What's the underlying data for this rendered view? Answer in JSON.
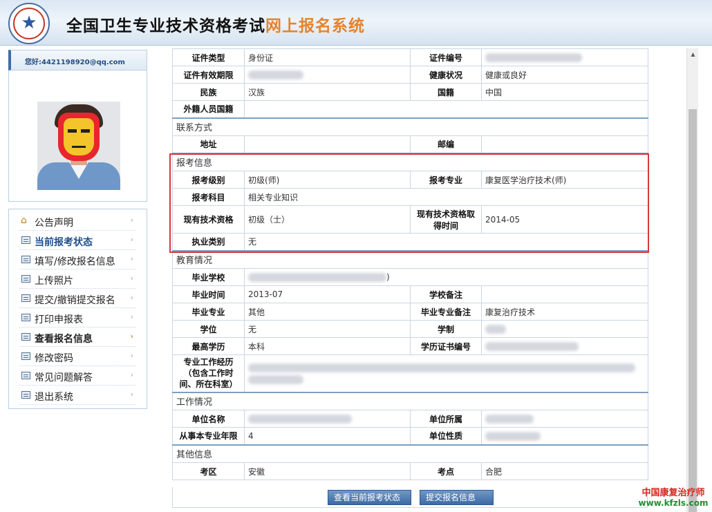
{
  "header": {
    "title_main": "全国卫生专业技术资格考试",
    "title_accent": "网上报名系统",
    "logo_icon": "star-emblem-icon"
  },
  "user": {
    "greeting": "您好:4421198920@qq.com"
  },
  "menu": [
    {
      "label": "公告声明",
      "icon": "home-icon"
    },
    {
      "label": "当前报考状态",
      "icon": "doc-icon"
    },
    {
      "label": "填写/修改报名信息",
      "icon": "doc-icon"
    },
    {
      "label": "上传照片",
      "icon": "doc-icon"
    },
    {
      "label": "提交/撤销提交报名",
      "icon": "doc-icon"
    },
    {
      "label": "打印申报表",
      "icon": "doc-icon"
    },
    {
      "label": "查看报名信息",
      "icon": "doc-icon"
    },
    {
      "label": "修改密码",
      "icon": "doc-icon"
    },
    {
      "label": "常见问题解答",
      "icon": "doc-icon"
    },
    {
      "label": "退出系统",
      "icon": "doc-icon"
    }
  ],
  "personal": {
    "id_type_label": "证件类型",
    "id_type": "身份证",
    "id_no_label": "证件编号",
    "id_valid_label": "证件有效期限",
    "health_label": "健康状况",
    "health": "健康或良好",
    "ethnic_label": "民族",
    "ethnic": "汉族",
    "nationality_label": "国籍",
    "nationality": "中国",
    "foreign_label": "外籍人员国籍"
  },
  "contact": {
    "section": "联系方式",
    "address_label": "地址",
    "zip_label": "邮编"
  },
  "exam": {
    "section": "报考信息",
    "level_label": "报考级别",
    "level": "初级(师)",
    "major_label": "报考专业",
    "major": "康复医学治疗技术(师)",
    "subject_label": "报考科目",
    "subject": "相关专业知识",
    "cur_qual_label": "现有技术资格",
    "cur_qual": "初级（士）",
    "qual_time_label": "现有技术资格取得时间",
    "qual_time": "2014-05",
    "practice_label": "执业类别",
    "practice": "无"
  },
  "education": {
    "section": "教育情况",
    "school_label": "毕业学校",
    "school_tail": ")",
    "grad_time_label": "毕业时间",
    "grad_time": "2013-07",
    "school_note_label": "学校备注",
    "grad_major_label": "毕业专业",
    "grad_major": "其他",
    "major_note_label": "毕业专业备注",
    "major_note": "康复治疗技术",
    "degree_label": "学位",
    "degree": "无",
    "schooling_label": "学制",
    "highest_label": "最高学历",
    "highest": "本科",
    "cert_label": "学历证书编号",
    "experience_label": "专业工作经历（包含工作时间、所在科室）"
  },
  "work": {
    "section": "工作情况",
    "unit_label": "单位名称",
    "unit_loc_label": "单位所属",
    "years_label": "从事本专业年限",
    "years": "4",
    "unit_type_label": "单位性质"
  },
  "other": {
    "section": "其他信息",
    "region_label": "考区",
    "region": "安徽",
    "site_label": "考点",
    "site": "合肥"
  },
  "buttons": {
    "view_status": "查看当前报考状态",
    "submit_info": "提交报名信息"
  },
  "watermark": {
    "line1": "中国康复治疗师",
    "line2": "www.kfzls.com"
  },
  "colors": {
    "accent_orange": "#e6822a",
    "highlight_red": "#d23a3a",
    "nav_blue": "#1f4f8e"
  }
}
